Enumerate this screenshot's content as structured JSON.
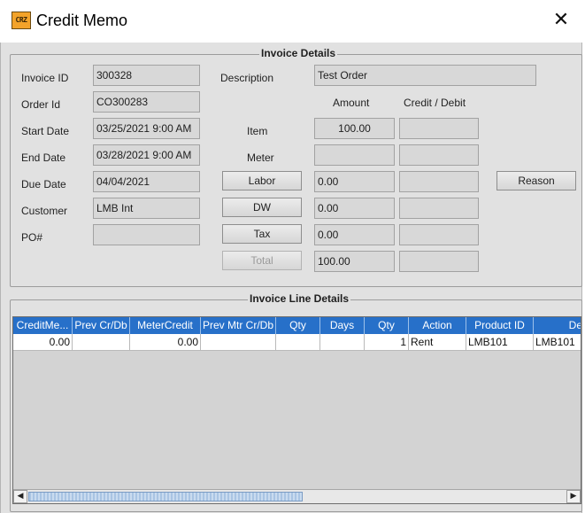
{
  "window": {
    "title": "Credit Memo",
    "icon": "CRZ",
    "close_glyph": "✕"
  },
  "invoice_details": {
    "legend": "Invoice Details",
    "labels": {
      "invoice_id": "Invoice ID",
      "order_id": "Order Id",
      "start_date": "Start Date",
      "end_date": "End  Date",
      "due_date": "Due Date",
      "customer": "Customer",
      "po": "PO#",
      "description": "Description",
      "amount": "Amount",
      "credit_debit": "Credit / Debit",
      "item": "Item",
      "meter": "Meter"
    },
    "values": {
      "invoice_id": "300328",
      "order_id": "CO300283",
      "start_date": "03/25/2021 9:00 AM",
      "end_date": "03/28/2021 9:00 AM",
      "due_date": "04/04/2021",
      "customer": "LMB Int",
      "po": "",
      "description": "Test Order",
      "item_amount": "100.00",
      "meter_amount": "",
      "labor_amount": "0.00",
      "dw_amount": "0.00",
      "tax_amount": "0.00",
      "total_amount": "100.00"
    },
    "buttons": {
      "labor": "Labor",
      "dw": "DW",
      "tax": "Tax",
      "total": "Total",
      "reason": "Reason"
    }
  },
  "line_details": {
    "legend": "Invoice Line Details",
    "columns": [
      "CreditMe...",
      "Prev Cr/Db",
      "MeterCredit",
      "Prev Mtr Cr/Db",
      "Qty",
      "Days",
      "Qty",
      "Action",
      "Product ID",
      "De"
    ],
    "rows": [
      [
        "0.00",
        "",
        "0.00",
        "",
        "",
        "",
        "1",
        "Rent",
        "LMB101",
        "LMB101"
      ]
    ]
  },
  "colors": {
    "header_blue": "#2770c9",
    "panel_gray": "#e1e1e1",
    "icon_orange": "#f3a32a"
  }
}
